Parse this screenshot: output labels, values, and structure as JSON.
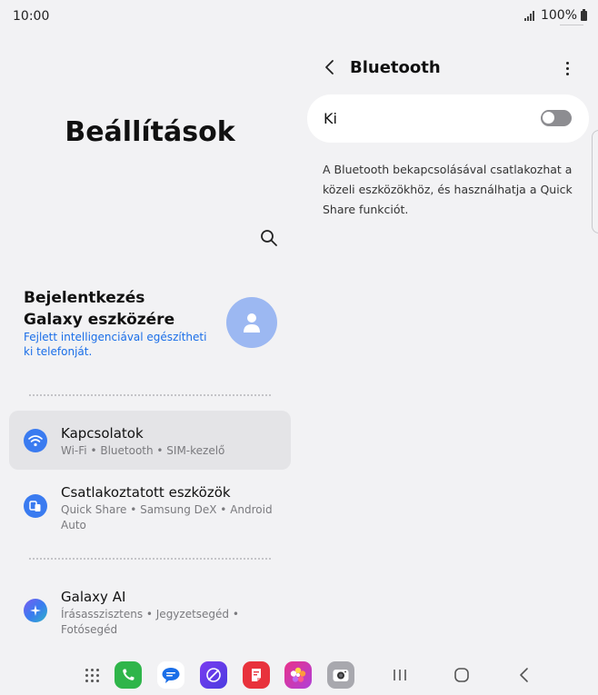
{
  "status_bar": {
    "time": "10:00",
    "battery": "100%"
  },
  "settings": {
    "title": "Beállítások",
    "account": {
      "title": "Bejelentkezés Galaxy eszközére",
      "subtitle": "Fejlett intelligenciával egészítheti ki telefonját."
    },
    "menu": [
      {
        "title": "Kapcsolatok",
        "subtitle": "Wi-Fi  •  Bluetooth  •  SIM-kezelő",
        "icon": "wifi-icon",
        "color": "#3a7bf0",
        "selected": true
      },
      {
        "title": "Csatlakoztatott eszközök",
        "subtitle": "Quick Share  •  Samsung DeX  •  Android Auto",
        "icon": "connected-devices-icon",
        "color": "#3a7bf0",
        "selected": false
      },
      {
        "title": "Galaxy AI",
        "subtitle": "Írásasszisztens  •  Jegyzetsegéd  •  Fotósegéd",
        "icon": "galaxy-ai-icon",
        "color": "#5b6ff0",
        "selected": false
      }
    ]
  },
  "bluetooth": {
    "title": "Bluetooth",
    "toggle_label": "Ki",
    "enabled": false,
    "description": "A Bluetooth bekapcsolásával csatlakozhat a közeli eszközökhöz, és használhatja a Quick Share funkciót."
  },
  "dock": {
    "apps": [
      "apps-grid-icon",
      "phone-icon",
      "messages-icon",
      "internet-icon",
      "notes-icon",
      "gallery-icon",
      "camera-icon"
    ],
    "nav": [
      "recents-icon",
      "home-icon",
      "back-icon"
    ]
  }
}
